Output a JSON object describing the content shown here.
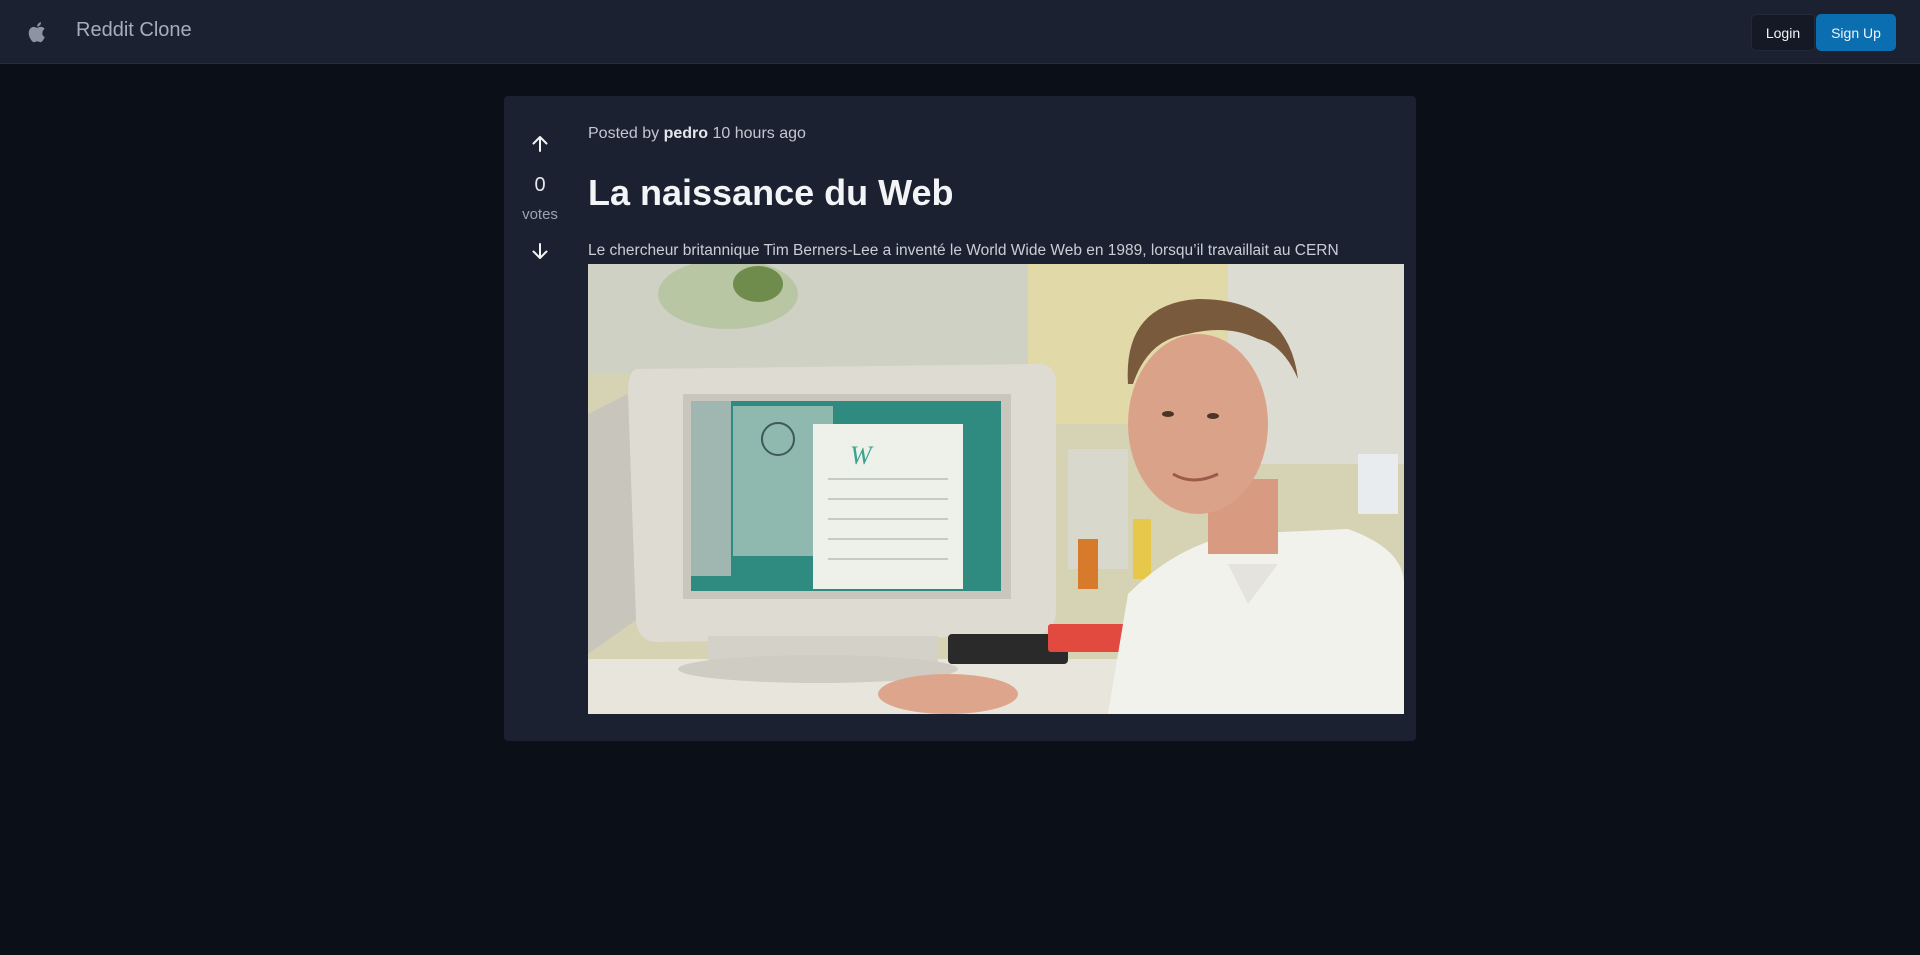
{
  "header": {
    "brand": "Reddit Clone",
    "logo_icon": "apple-icon",
    "login_label": "Login",
    "signup_label": "Sign Up"
  },
  "post": {
    "votes": "0",
    "votes_label": "votes",
    "posted_by_prefix": "Posted by",
    "author": "pedro",
    "time_ago": "10 hours ago",
    "title": "La naissance du Web",
    "body": "Le chercheur britannique Tim Berners-Lee a inventé le World Wide Web en 1989, lorsqu’il travaillait au CERN",
    "image_icon": "photo-of-man-at-computer"
  },
  "colors": {
    "accent": "#0b6eb0",
    "page_bg": "#0b0f17",
    "card_bg": "#1b2130"
  }
}
